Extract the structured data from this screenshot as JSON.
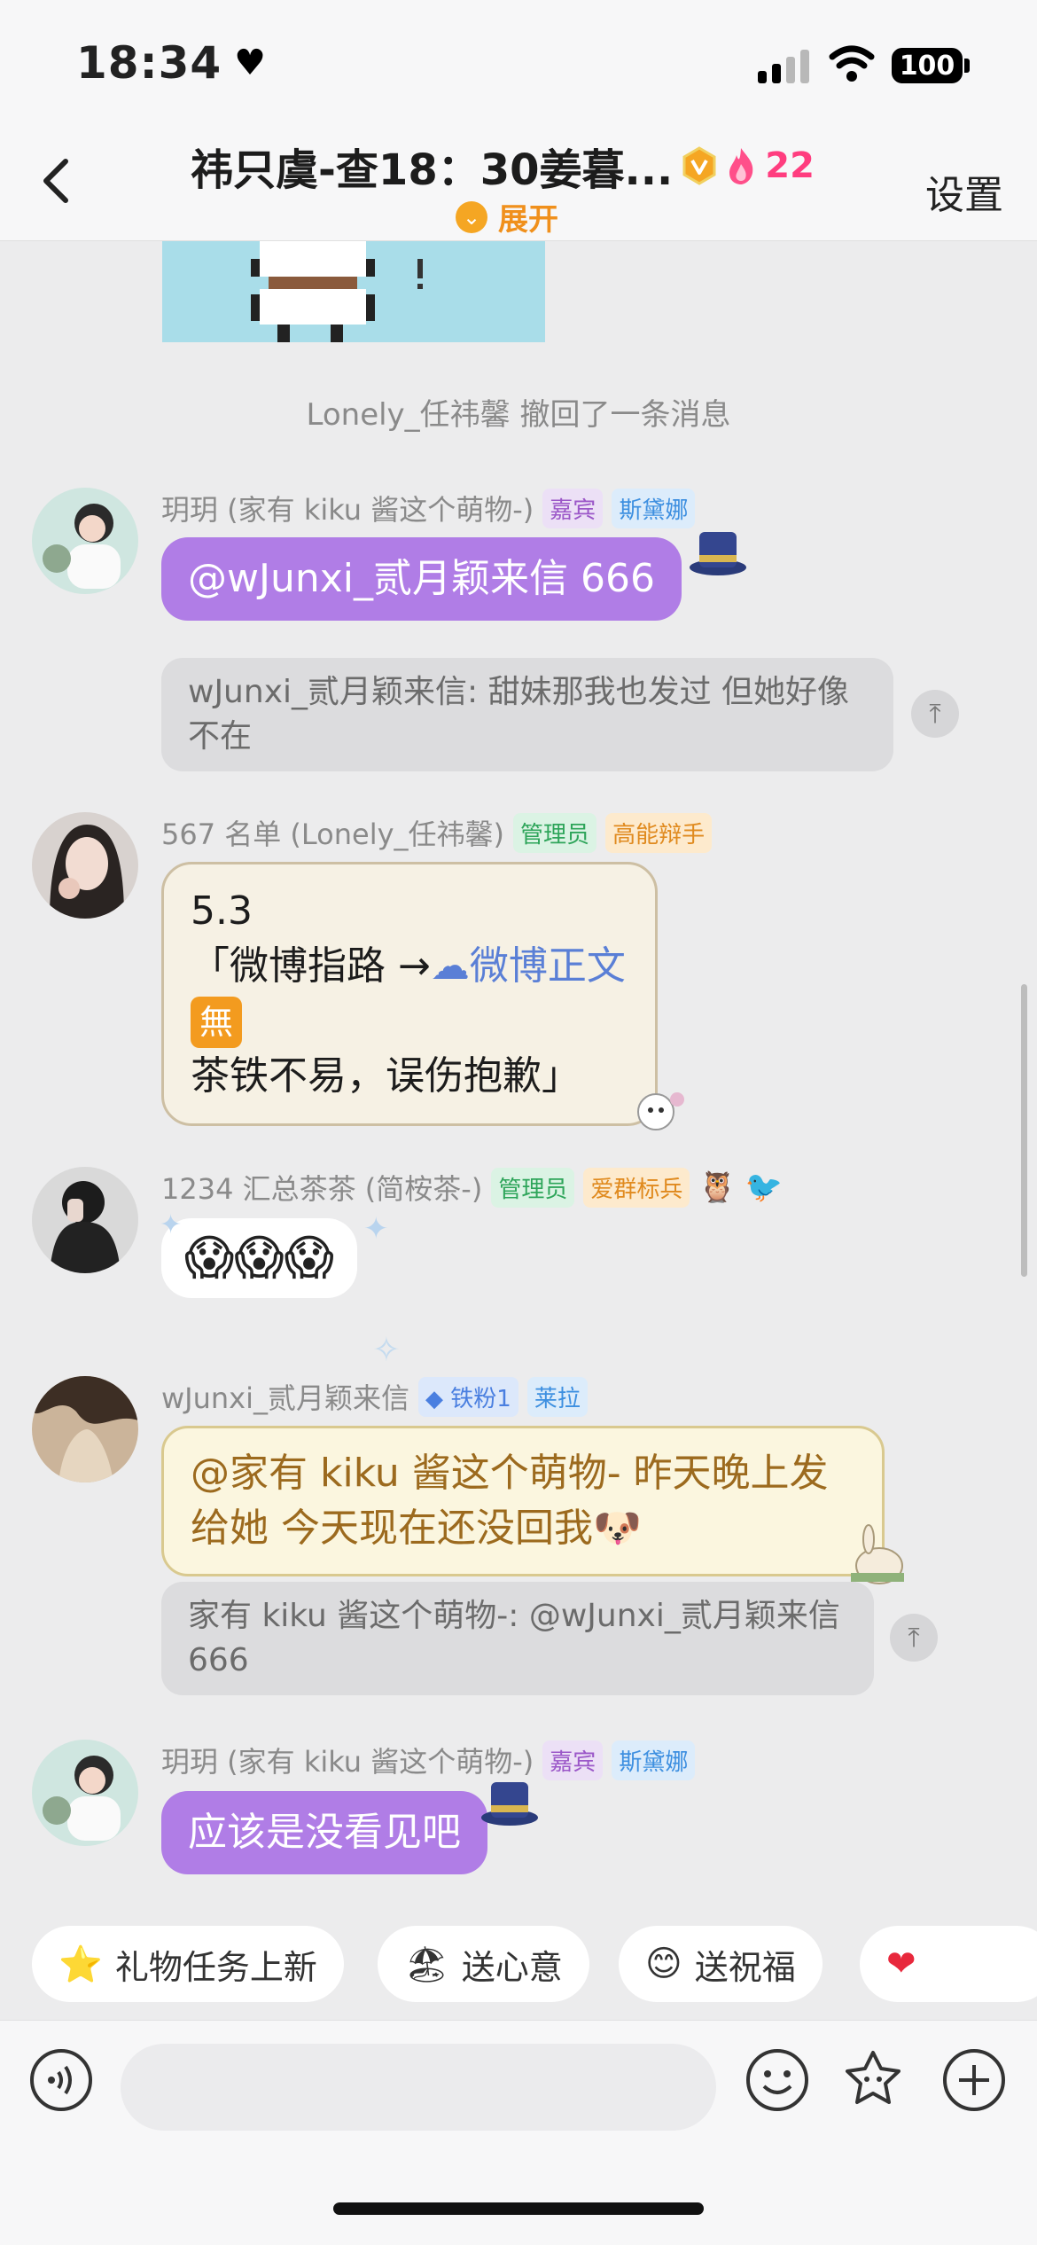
{
  "status": {
    "time": "18:34",
    "battery": "100"
  },
  "header": {
    "title": "祎只虞-查18：30姜暮...",
    "fire_count": "22",
    "expand_label": "展开",
    "settings_label": "设置"
  },
  "system": {
    "recall_text": "Lonely_任祎馨 撤回了一条消息"
  },
  "messages": [
    {
      "sender": "玥玥 (家有 kiku 酱这个萌物-)",
      "tags": [
        "嘉宾",
        "斯黛娜"
      ],
      "text": "@wJunxi_贰月颖来信 666",
      "quote": "wJunxi_贰月颖来信: 甜妹那我也发过 但她好像不在"
    },
    {
      "sender": "567 名单 (Lonely_任祎馨)",
      "tags": [
        "管理员",
        "高能辩手"
      ],
      "lines": [
        "5.3",
        "「微博指路 →",
        "微博正文",
        "無",
        "茶铁不易，误伤抱歉」"
      ]
    },
    {
      "sender": "1234 汇总茶茶 (简桉茶-)",
      "tags": [
        "管理员",
        "爱群标兵"
      ],
      "text": "😱😱😱"
    },
    {
      "sender": "wJunxi_贰月颖来信",
      "tags": [
        "铁粉1",
        "莱拉"
      ],
      "text": "@家有 kiku 酱这个萌物- 昨天晚上发给她 今天现在还没回我",
      "quote": "家有 kiku 酱这个萌物-: @wJunxi_贰月颖来信 666"
    },
    {
      "sender": "玥玥 (家有 kiku 酱这个萌物-)",
      "tags": [
        "嘉宾",
        "斯黛娜"
      ],
      "text": "应该是没看见吧"
    }
  ],
  "chips": [
    {
      "label": "礼物任务上新",
      "icon": "star-icon"
    },
    {
      "label": "送心意",
      "icon": "gift-icon"
    },
    {
      "label": "送祝福",
      "icon": "blessing-icon"
    },
    {
      "label": "",
      "icon": "heart-icon"
    }
  ],
  "colors": {
    "accent_purple": "#b07de6",
    "fire_pink": "#ff3d7f",
    "expand_orange": "#f0901c"
  }
}
